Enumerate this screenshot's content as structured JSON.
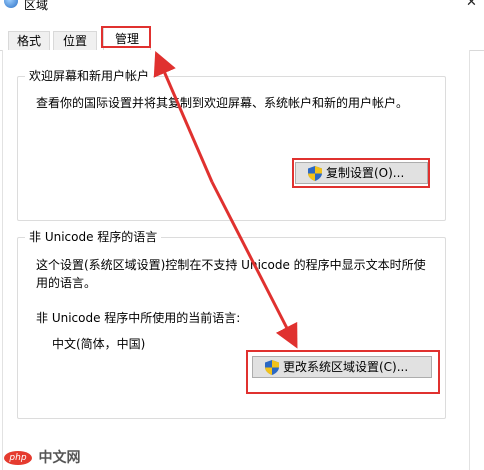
{
  "window": {
    "title": "区域",
    "close_glyph": "✕"
  },
  "tabs": [
    {
      "label": "格式"
    },
    {
      "label": "位置"
    },
    {
      "label": "管理"
    }
  ],
  "welcome_group": {
    "title": "欢迎屏幕和新用户帐户",
    "description": "查看你的国际设置并将其复制到欢迎屏幕、系统帐户和新的用户帐户。",
    "copy_button": "复制设置(O)..."
  },
  "unicode_group": {
    "title": "非 Unicode 程序的语言",
    "description": "这个设置(系统区域设置)控制在不支持 Unicode 的程序中显示文本时所使用的语言。",
    "current_label": "非 Unicode 程序中所使用的当前语言:",
    "current_value": "中文(简体，中国)",
    "change_button": "更改系统区域设置(C)..."
  },
  "watermark": {
    "logo": "php",
    "text": "中文网"
  },
  "colors": {
    "highlight": "#e0312f",
    "button_bg": "#e1e1e1"
  },
  "icons": [
    "app-icon",
    "close-icon",
    "shield-icon"
  ]
}
